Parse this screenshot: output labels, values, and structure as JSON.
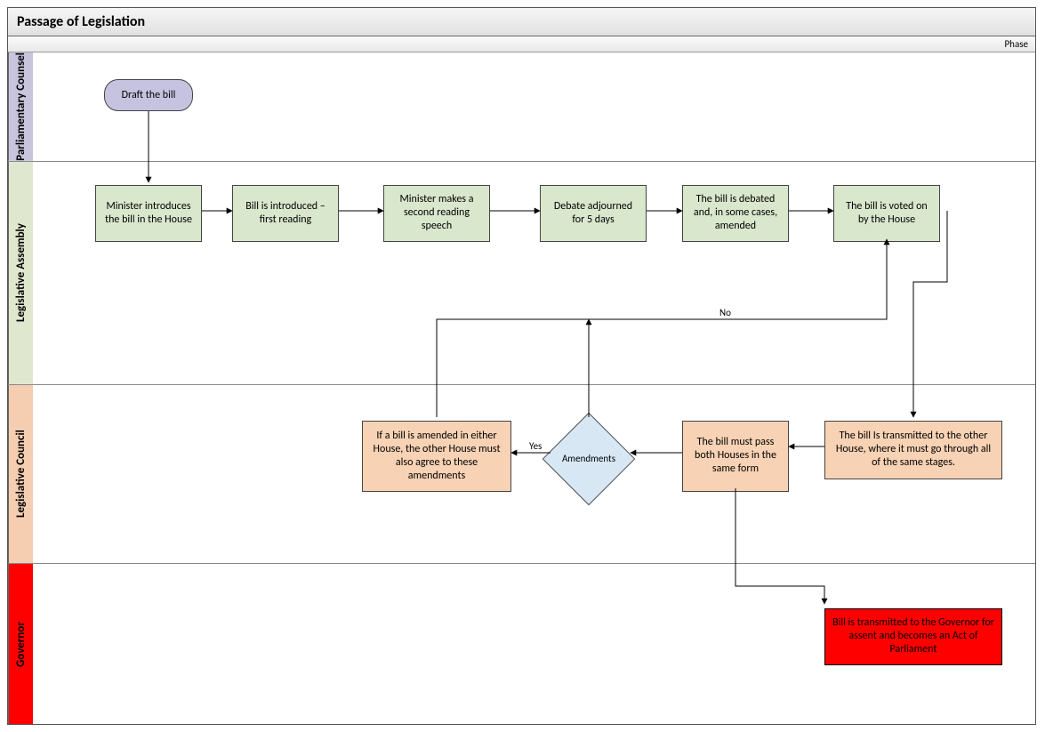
{
  "title": "Passage of Legislation",
  "phase_label": "Phase",
  "lanes": {
    "pc": "Parliamentary Counsel",
    "la": "Legislative Assembly",
    "lc": "Legislative Council",
    "gv": "Governor"
  },
  "nodes": {
    "start": "Draft the bill",
    "la1": "Minister introduces the bill in the House",
    "la2": "Bill is introduced – first reading",
    "la3": "Minister makes a second reading speech",
    "la4": "Debate adjourned for 5 days",
    "la5": "The bill is debated and, in some cases, amended",
    "la6": "The bill is voted on by the House",
    "lc1": "The bill Is transmitted to the other House, where it must go through all of the same stages.",
    "lc2": "The bill must pass both Houses in the same form",
    "lc3": "Amendments",
    "lc4": "If a bill is amended in either House, the other House must also agree to these amendments",
    "gov": "Bill is transmitted to the Governor for assent and becomes an Act of Parliament"
  },
  "edge_labels": {
    "yes": "Yes",
    "no": "No"
  }
}
